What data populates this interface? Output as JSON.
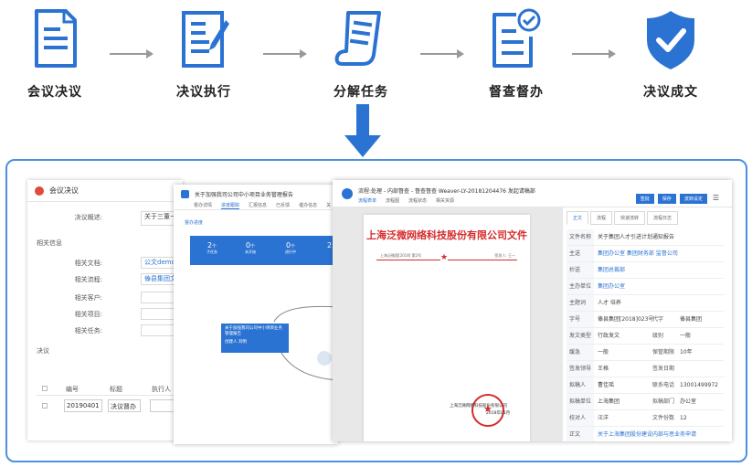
{
  "workflow": {
    "steps": [
      {
        "label": "会议决议",
        "icon": "document-icon"
      },
      {
        "label": "决议执行",
        "icon": "document-pen-icon"
      },
      {
        "label": "分解任务",
        "icon": "scroll-icon"
      },
      {
        "label": "督查督办",
        "icon": "document-check-icon"
      },
      {
        "label": "决议成文",
        "icon": "shield-check-icon"
      }
    ],
    "accent": "#2b73d2",
    "arrow_color": "#999999"
  },
  "shot1": {
    "title": "会议决议",
    "summary_label": "决议概述:",
    "summary_value": "关于三董一",
    "related_section": "相关信息",
    "fields": [
      {
        "label": "相关文档:",
        "value": "公文demo回"
      },
      {
        "label": "相关流程:",
        "value": "傣县集团文件"
      },
      {
        "label": "相关客户:",
        "value": ""
      },
      {
        "label": "相关项目:",
        "value": ""
      },
      {
        "label": "相关任务:",
        "value": ""
      }
    ],
    "resolution_section": "决议",
    "table": {
      "headers": [
        "编号",
        "标题",
        "执行人"
      ],
      "rows": [
        [
          "20190401",
          "决议督办",
          ""
        ]
      ]
    }
  },
  "shot2": {
    "title": "关于加强我司公司中小项目业务管理报告",
    "tabs": [
      "督办详情",
      "进度跟踪",
      "汇报信息",
      "已反馈",
      "催办信息",
      "关"
    ],
    "active_tab": 1,
    "section": "督办进度",
    "stats": [
      {
        "value": "2",
        "unit": "个",
        "label": "子任务"
      },
      {
        "value": "0",
        "unit": "个",
        "label": "未开始"
      },
      {
        "value": "0",
        "unit": "个",
        "label": "进行中"
      },
      {
        "value": "2",
        "unit": "",
        "label": ""
      }
    ],
    "node": {
      "title": "关于加强我司公司中小项目业务管理报告",
      "meta": "创建人  刘明"
    }
  },
  "shot3": {
    "title": "流程:处理 - 内部督查 - 督查督查 Weaver-LY-20181204476  发起请稿部",
    "tabs": [
      "流程表单",
      "流程图",
      "流程状态",
      "相关资源"
    ],
    "buttons": [
      "签批",
      "保存",
      "流转设定"
    ],
    "doc": {
      "title": "上海泛微网络科技股份有限公司文件",
      "sub_left": "上海泛微国[2018] 第2号",
      "sub_right": "签发人: 王一",
      "sign": "上海泛微网络科技股份有限公司",
      "date": "2018年01月"
    },
    "right_tabs": [
      "正文",
      "流程",
      "快速流转",
      "流程日志"
    ],
    "form": [
      {
        "k": "文件名称",
        "v": "关于集团人才引进计划通知报告",
        "link": false
      },
      {
        "k": "主送",
        "v": "集团办公室   集团财务部   监督公司",
        "link": true
      },
      {
        "k": "抄送",
        "v": "集团总裁部",
        "link": true
      },
      {
        "k": "主办单位",
        "v": "集团办公室",
        "link": true
      },
      {
        "k": "主题词",
        "v": "人才   培养",
        "link": false
      },
      {
        "k": "字号",
        "v": "傣县集团[2018]023号",
        "link": false,
        "k2": "代字",
        "v2": "傣县集团"
      },
      {
        "k": "发文类型",
        "v": "行政发文",
        "link": false,
        "k2": "级别",
        "v2": "一般"
      },
      {
        "k": "缓急",
        "v": "一般",
        "link": false,
        "k2": "保管期限",
        "v2": "10年"
      },
      {
        "k": "签发领导",
        "v": "王格",
        "link": false,
        "k2": "签发日期",
        "v2": ""
      },
      {
        "k": "拟稿人",
        "v": "曹佳瑶",
        "link": false,
        "k2": "联系电话",
        "v2": "13001499972"
      },
      {
        "k": "拟稿单位",
        "v": "上海集团",
        "link": false,
        "k2": "拟稿部门",
        "v2": "办公室"
      },
      {
        "k": "校对人",
        "v": "汪洋",
        "link": false,
        "k2": "文件份数",
        "v2": "12"
      },
      {
        "k": "正文",
        "v": "关于上海集团股份建设内部与思业务申请",
        "link": true
      }
    ]
  }
}
